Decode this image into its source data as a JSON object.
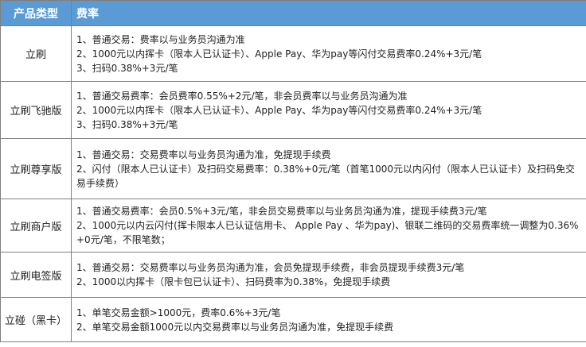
{
  "header": {
    "col1": "产品类型",
    "col2": "费率"
  },
  "rows": [
    {
      "name": "立刷",
      "lines": [
        "1、普通交易：费率以与业务员沟通为准",
        "2、1000元以内挥卡（限本人已认证卡）、Apple Pay、华为pay等闪付交易费率0.24%+3元/笔",
        "3、扫码0.38%+3元/笔"
      ]
    },
    {
      "name": "立刷飞驰版",
      "lines": [
        "1、普通交易费率：会员费率0.55%+2元/笔，非会员费率以与业务员沟通为准",
        "2、1000元以内挥卡（限本人已认证卡）、Apple Pay、华为pay等闪付交易费率0.24%+3元/笔",
        "3、扫码0.38%+3元/笔"
      ]
    },
    {
      "name": "立刷尊享版",
      "lines": [
        "1、普通交易：交易费率以与业务员沟通为准，免提现手续费",
        "2、闪付（限本人已认证卡）及扫码交易费率：0.38%+0元/笔（首笔1000元以内闪付（限本人已认证卡）及扫码免交易手续费）"
      ]
    },
    {
      "name": "立刷商户版",
      "lines": [
        "1、普通交易费率：会员0.5%+3元/笔，非会员交易费率以与业务员沟通为准，提现手续费3元/笔",
        "2、1000元以内云闪付(挥卡限本人已认证信用卡、 Apple Pay 、华为pay)、银联二维码的交易费率统一调整为0.36%+0元/笔，不限笔数；"
      ]
    },
    {
      "name": "立刷电签版",
      "lines": [
        "1、普通交易：交易费率以与业务员沟通为准，会员免提现手续费，非会员提现手续费3元/笔",
        "2、1000以内挥卡（限卡包已认证卡）、扫码费率为0.38%，免提现手续费"
      ]
    },
    {
      "name": "立碰（黑卡）",
      "lines": [
        "1、单笔交易金额>1000元，费率0.6%+3元/笔",
        "2、单笔交易金额1000元以内交易费率以与业务员沟通为准，免提现手续费"
      ]
    }
  ]
}
